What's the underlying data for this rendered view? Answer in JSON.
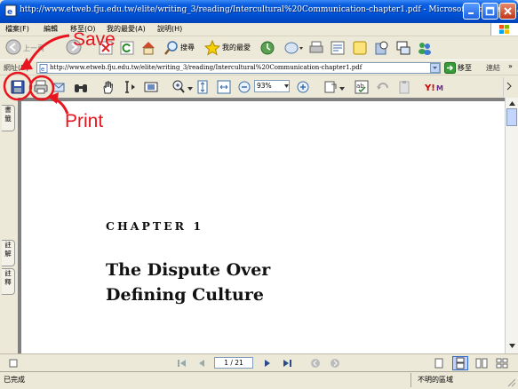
{
  "window": {
    "title": "http://www.etweb.fju.edu.tw/elite/writing_3/reading/Intercultural%20Communication-chapter1.pdf - Microsoft Internet Ex..."
  },
  "menu": {
    "items": [
      "檔案(F)",
      "編輯",
      "移至(O)",
      "我的最愛(A)",
      "說明(H)"
    ]
  },
  "nav": {
    "back_label": "上一頁",
    "search_label": "搜尋",
    "favorites_label": "我的最愛"
  },
  "address": {
    "label": "網址(D)",
    "url": "http://www.etweb.fju.edu.tw/elite/writing_3/reading/Intercultural%20Communication-chapter1.pdf",
    "go_label": "移至",
    "links_label": "連結"
  },
  "pdf_toolbar": {
    "zoom": "93%"
  },
  "sidebar": {
    "tabs": [
      "書籤",
      "註解",
      "註釋"
    ]
  },
  "document": {
    "chapter": "CHAPTER 1",
    "title_line1": "The Dispute Over",
    "title_line2": "Defining Culture"
  },
  "pagination": {
    "page_display": "1 / 21"
  },
  "annotations": {
    "save_label": "Save",
    "print_label": "Print",
    "color": "#e8141e"
  },
  "status": {
    "text": "已完成",
    "zone": "不明的區域"
  }
}
